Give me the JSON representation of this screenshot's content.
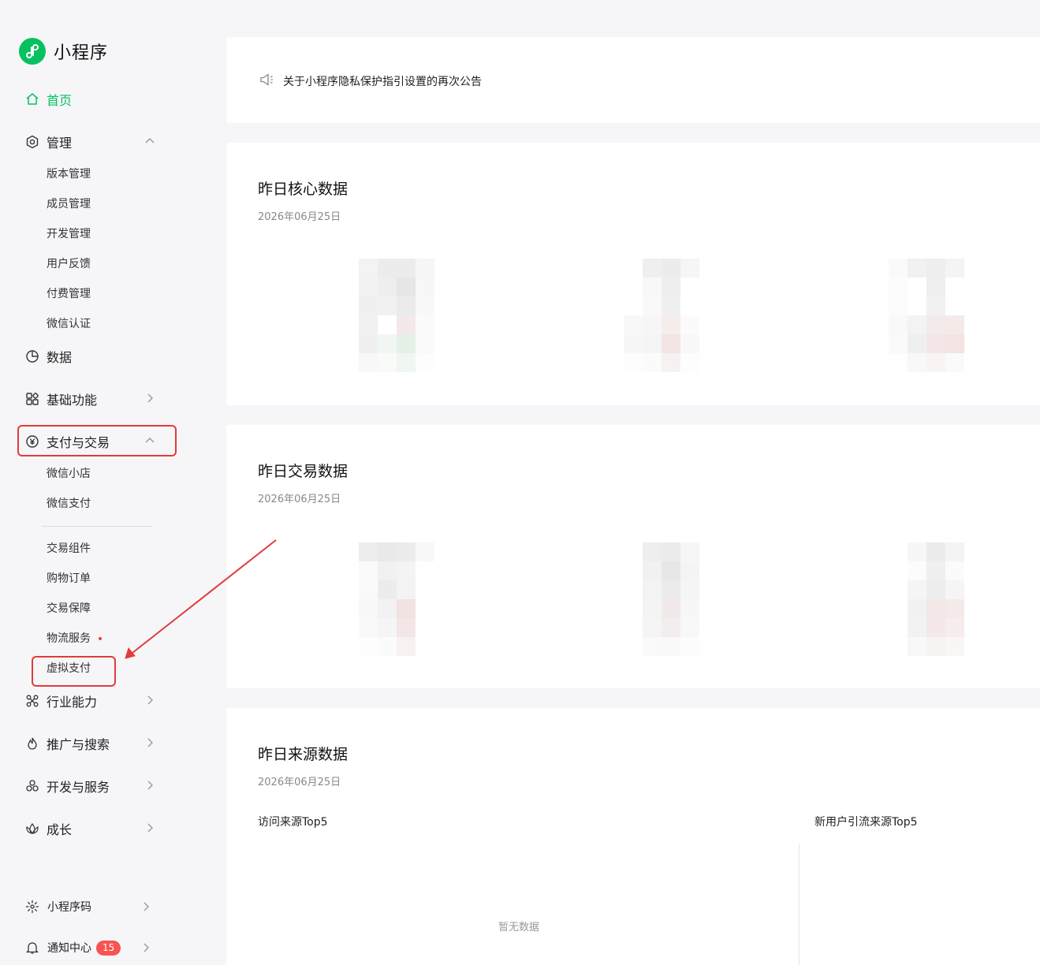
{
  "app": {
    "title": "小程序"
  },
  "sidebar": {
    "home": "首页",
    "manage": {
      "label": "管理",
      "children": [
        "版本管理",
        "成员管理",
        "开发管理",
        "用户反馈",
        "付费管理",
        "微信认证"
      ]
    },
    "data": "数据",
    "basic": "基础功能",
    "pay": {
      "label": "支付与交易",
      "children": [
        "微信小店",
        "微信支付"
      ],
      "children2": [
        "交易组件",
        "购物订单",
        "交易保障",
        "物流服务",
        "虚拟支付"
      ]
    },
    "industry": "行业能力",
    "promo": "推广与搜索",
    "devservice": "开发与服务",
    "growth": "成长",
    "qrcode": "小程序码",
    "notify": {
      "label": "通知中心",
      "badge": "15"
    }
  },
  "notice": {
    "text": "关于小程序隐私保护指引设置的再次公告"
  },
  "core": {
    "title": "昨日核心数据",
    "date": "2026年06月25日"
  },
  "trade": {
    "title": "昨日交易数据",
    "date": "2026年06月25日"
  },
  "source": {
    "title": "昨日来源数据",
    "date": "2026年06月25日",
    "visit_label": "访问来源Top5",
    "new_label": "新用户引流来源Top5",
    "empty": "暂无数据"
  },
  "colors": {
    "accent": "#07c160",
    "highlight": "#e33a3a",
    "badge": "#fa5151"
  }
}
